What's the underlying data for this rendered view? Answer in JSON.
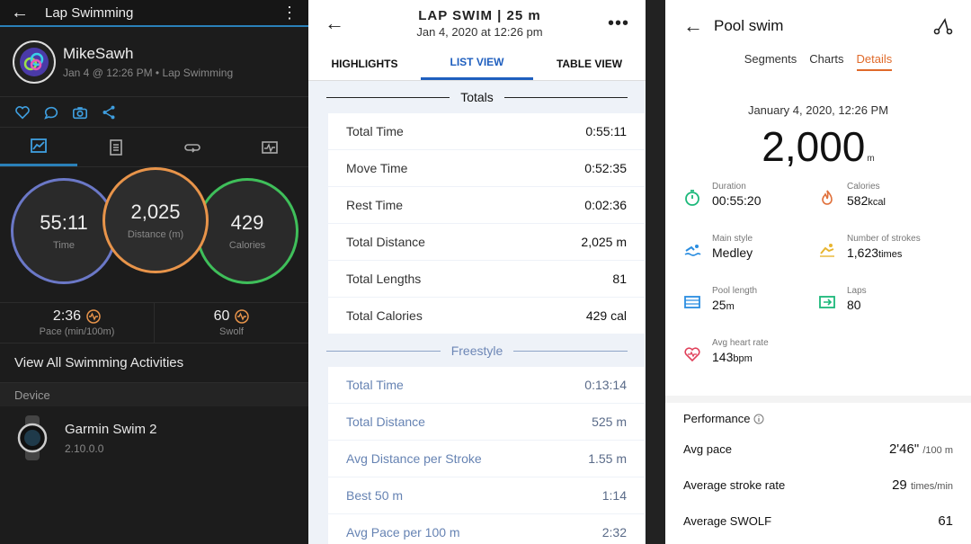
{
  "garmin": {
    "title": "Lap Swimming",
    "user": {
      "name": "MikeSawh",
      "meta": "Jan 4 @ 12:26 PM • Lap Swimming"
    },
    "time": {
      "value": "55:11",
      "label": "Time"
    },
    "distance": {
      "value": "2,025",
      "label": "Distance (m)"
    },
    "calories": {
      "value": "429",
      "label": "Calories"
    },
    "pace": {
      "value": "2:36",
      "label": "Pace (min/100m)"
    },
    "swolf": {
      "value": "60",
      "label": "Swolf"
    },
    "view_all": "View All Swimming Activities",
    "device_header": "Device",
    "device": {
      "name": "Garmin Swim 2",
      "version": "2.10.0.0"
    },
    "colors": {
      "time_ring": "#6b78c7",
      "distance_ring": "#e8944a",
      "calories_ring": "#3fbf5a",
      "accent": "#2a80b9"
    }
  },
  "list": {
    "title": "LAP SWIM | 25 m",
    "subtitle": "Jan 4, 2020 at 12:26 pm",
    "tabs": [
      "HIGHLIGHTS",
      "LIST VIEW",
      "TABLE VIEW"
    ],
    "totals_label": "Totals",
    "totals": [
      {
        "label": "Total Time",
        "value": "0:55:11"
      },
      {
        "label": "Move Time",
        "value": "0:52:35"
      },
      {
        "label": "Rest Time",
        "value": "0:02:36"
      },
      {
        "label": "Total Distance",
        "value": "2,025 m"
      },
      {
        "label": "Total Lengths",
        "value": "81"
      },
      {
        "label": "Total Calories",
        "value": "429 cal"
      }
    ],
    "freestyle_label": "Freestyle",
    "freestyle": [
      {
        "label": "Total Time",
        "value": "0:13:14"
      },
      {
        "label": "Total Distance",
        "value": "525 m"
      },
      {
        "label": "Avg Distance per Stroke",
        "value": "1.55 m"
      },
      {
        "label": "Best 50 m",
        "value": "1:14"
      },
      {
        "label": "Avg Pace per 100 m",
        "value": "2:32"
      }
    ]
  },
  "huawei": {
    "title": "Pool swim",
    "tabs": [
      "Segments",
      "Charts",
      "Details"
    ],
    "date": "January 4, 2020, 12:26 PM",
    "distance": "2,000",
    "distance_unit": "m",
    "metrics": [
      {
        "label": "Duration",
        "value": "00:55:20",
        "unit": "",
        "icon": "stopwatch-icon"
      },
      {
        "label": "Calories",
        "value": "582",
        "unit": "kcal",
        "icon": "flame-icon"
      },
      {
        "label": "Main style",
        "value": "Medley",
        "unit": "",
        "icon": "swimmer-icon"
      },
      {
        "label": "Number of strokes",
        "value": "1,623",
        "unit": "times",
        "icon": "stroke-icon"
      },
      {
        "label": "Pool length",
        "value": "25",
        "unit": "m",
        "icon": "pool-icon"
      },
      {
        "label": "Laps",
        "value": "80",
        "unit": "",
        "icon": "laps-icon"
      },
      {
        "label": "Avg heart rate",
        "value": "143",
        "unit": "bpm",
        "icon": "heart-rate-icon"
      }
    ],
    "performance_label": "Performance",
    "performance": [
      {
        "label": "Avg pace",
        "value": "2'46\"",
        "unit": "/100 m"
      },
      {
        "label": "Average stroke rate",
        "value": "29",
        "unit": "times/min"
      },
      {
        "label": "Average SWOLF",
        "value": "61",
        "unit": ""
      }
    ]
  }
}
